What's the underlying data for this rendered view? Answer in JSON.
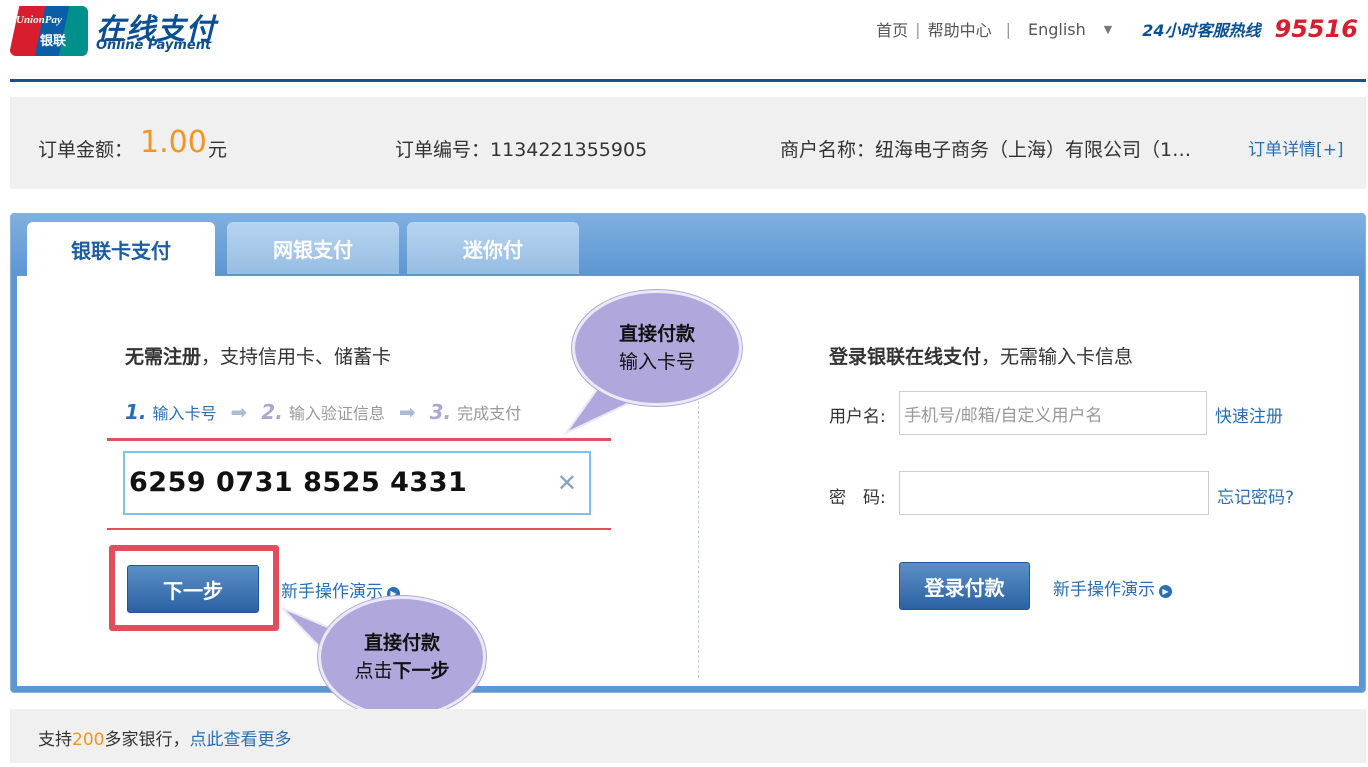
{
  "header": {
    "logo_text_top": "UnionPay",
    "logo_text_bottom": "银联",
    "title": "在线支付",
    "subtitle": "Online Payment",
    "nav": {
      "home": "首页",
      "help": "帮助中心",
      "language": "English",
      "hotline_label": "24小时客服热线",
      "hotline_number": "95516"
    }
  },
  "order": {
    "amount_label": "订单金额：",
    "amount": "1.00",
    "amount_unit": "元",
    "number_label": "订单编号：",
    "number": "1134221355905",
    "merchant_label": "商户名称：",
    "merchant": "纽海电子商务（上海）有限公司（1…",
    "details_link": "订单详情[+]"
  },
  "tabs": [
    {
      "label": "银联卡支付",
      "active": true
    },
    {
      "label": "网银支付",
      "active": false
    },
    {
      "label": "迷你付",
      "active": false
    }
  ],
  "card_pay": {
    "title_bold": "无需注册",
    "title_rest": "，支持信用卡、储蓄卡",
    "steps": [
      {
        "num": "1.",
        "label": "输入卡号"
      },
      {
        "num": "2.",
        "label": "输入验证信息"
      },
      {
        "num": "3.",
        "label": "完成支付"
      }
    ],
    "card_number": "6259 0731 8525 4331",
    "next_button": "下一步",
    "demo_link": "新手操作演示"
  },
  "login_pay": {
    "title_bold": "登录银联在线支付",
    "title_rest": "，无需输入卡信息",
    "username_label": "用户名:",
    "username_placeholder": "手机号/邮箱/自定义用户名",
    "register_link": "快速注册",
    "password_label": "密　码:",
    "forgot_link": "忘记密码?",
    "login_button": "登录付款",
    "demo_link": "新手操作演示"
  },
  "callouts": {
    "top": {
      "line1": "直接付款",
      "line2": "输入卡号"
    },
    "bottom": {
      "line1": "直接付款",
      "line2_prefix": "点击",
      "line2_bold": "下一步"
    }
  },
  "footer": {
    "prefix": "支持",
    "count": "200",
    "suffix": "多家银行，",
    "more_link": "点此查看更多"
  },
  "colors": {
    "brand_blue": "#0a4f94",
    "brand_red": "#d81e2e",
    "accent_orange": "#f7931e",
    "link_blue": "#2a6fb5",
    "highlight_red": "#e24e5c",
    "callout_purple": "#b0a8dc"
  }
}
